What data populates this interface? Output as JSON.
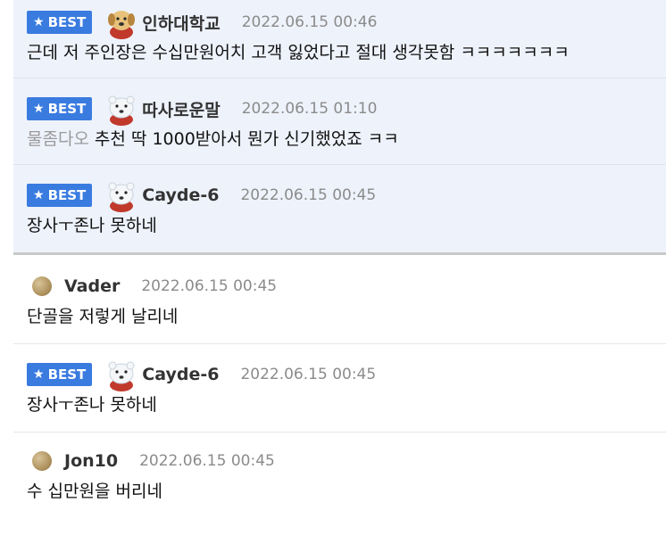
{
  "colors": {
    "best_badge": "#3a7be0",
    "best_row_bg": "#eef2fb",
    "date": "#8b8b8b",
    "mention": "#9a9a9a"
  },
  "comments": [
    {
      "best": true,
      "badge": "BEST",
      "avatar": "dog-avatar-icon",
      "nick": "인하대학교",
      "date": "2022.06.15 00:46",
      "mention": "",
      "text": "근데 저 주인장은 수십만원어치 고객 잃었다고 절대 생각못함 ㅋㅋㅋㅋㅋㅋㅋ"
    },
    {
      "best": true,
      "badge": "BEST",
      "avatar": "polar-bear-avatar-icon",
      "nick": "따사로운말",
      "date": "2022.06.15 01:10",
      "mention": "물좀다오",
      "text": "추천 딱 1000받아서 뭔가 신기했었죠 ㅋㅋ"
    },
    {
      "best": true,
      "badge": "BEST",
      "avatar": "polar-bear-avatar-icon",
      "nick": "Cayde-6",
      "date": "2022.06.15 00:45",
      "mention": "",
      "text": "장사ㅜ존나 못하네"
    },
    {
      "best": false,
      "avatar": "default-ball-avatar-icon",
      "nick": "Vader",
      "date": "2022.06.15 00:45",
      "mention": "",
      "text": "단골을 저렇게 날리네"
    },
    {
      "best": true,
      "badge": "BEST",
      "avatar": "polar-bear-avatar-icon",
      "nick": "Cayde-6",
      "date": "2022.06.15 00:45",
      "mention": "",
      "text": "장사ㅜ존나 못하네"
    },
    {
      "best": false,
      "avatar": "default-ball-avatar-icon",
      "nick": "Jon10",
      "date": "2022.06.15 00:45",
      "mention": "",
      "text": "수 십만원을 버리네"
    }
  ]
}
